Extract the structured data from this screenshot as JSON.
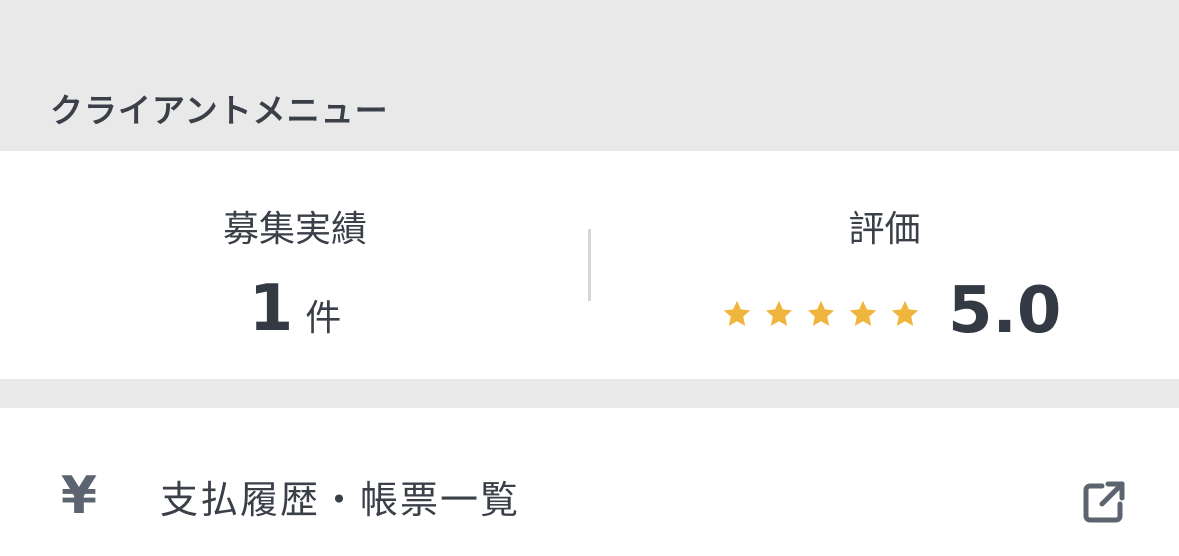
{
  "section": {
    "title": "クライアントメニュー"
  },
  "stats": {
    "recruitment": {
      "label": "募集実績",
      "count": "1",
      "unit": "件"
    },
    "rating": {
      "label": "評価",
      "value": "5.0",
      "stars_filled": 5,
      "stars_total": 5,
      "star_color": "#f0b53c"
    }
  },
  "menu": {
    "items": [
      {
        "icon": "yen-icon",
        "icon_glyph": "¥",
        "label": "支払履歴・帳票一覧",
        "trailing_icon": "external-link-icon"
      }
    ]
  },
  "colors": {
    "background_gray": "#e9e9ea",
    "text_dark": "#3a3f48",
    "icon_gray": "#5c6470",
    "star": "#f0b53c"
  }
}
